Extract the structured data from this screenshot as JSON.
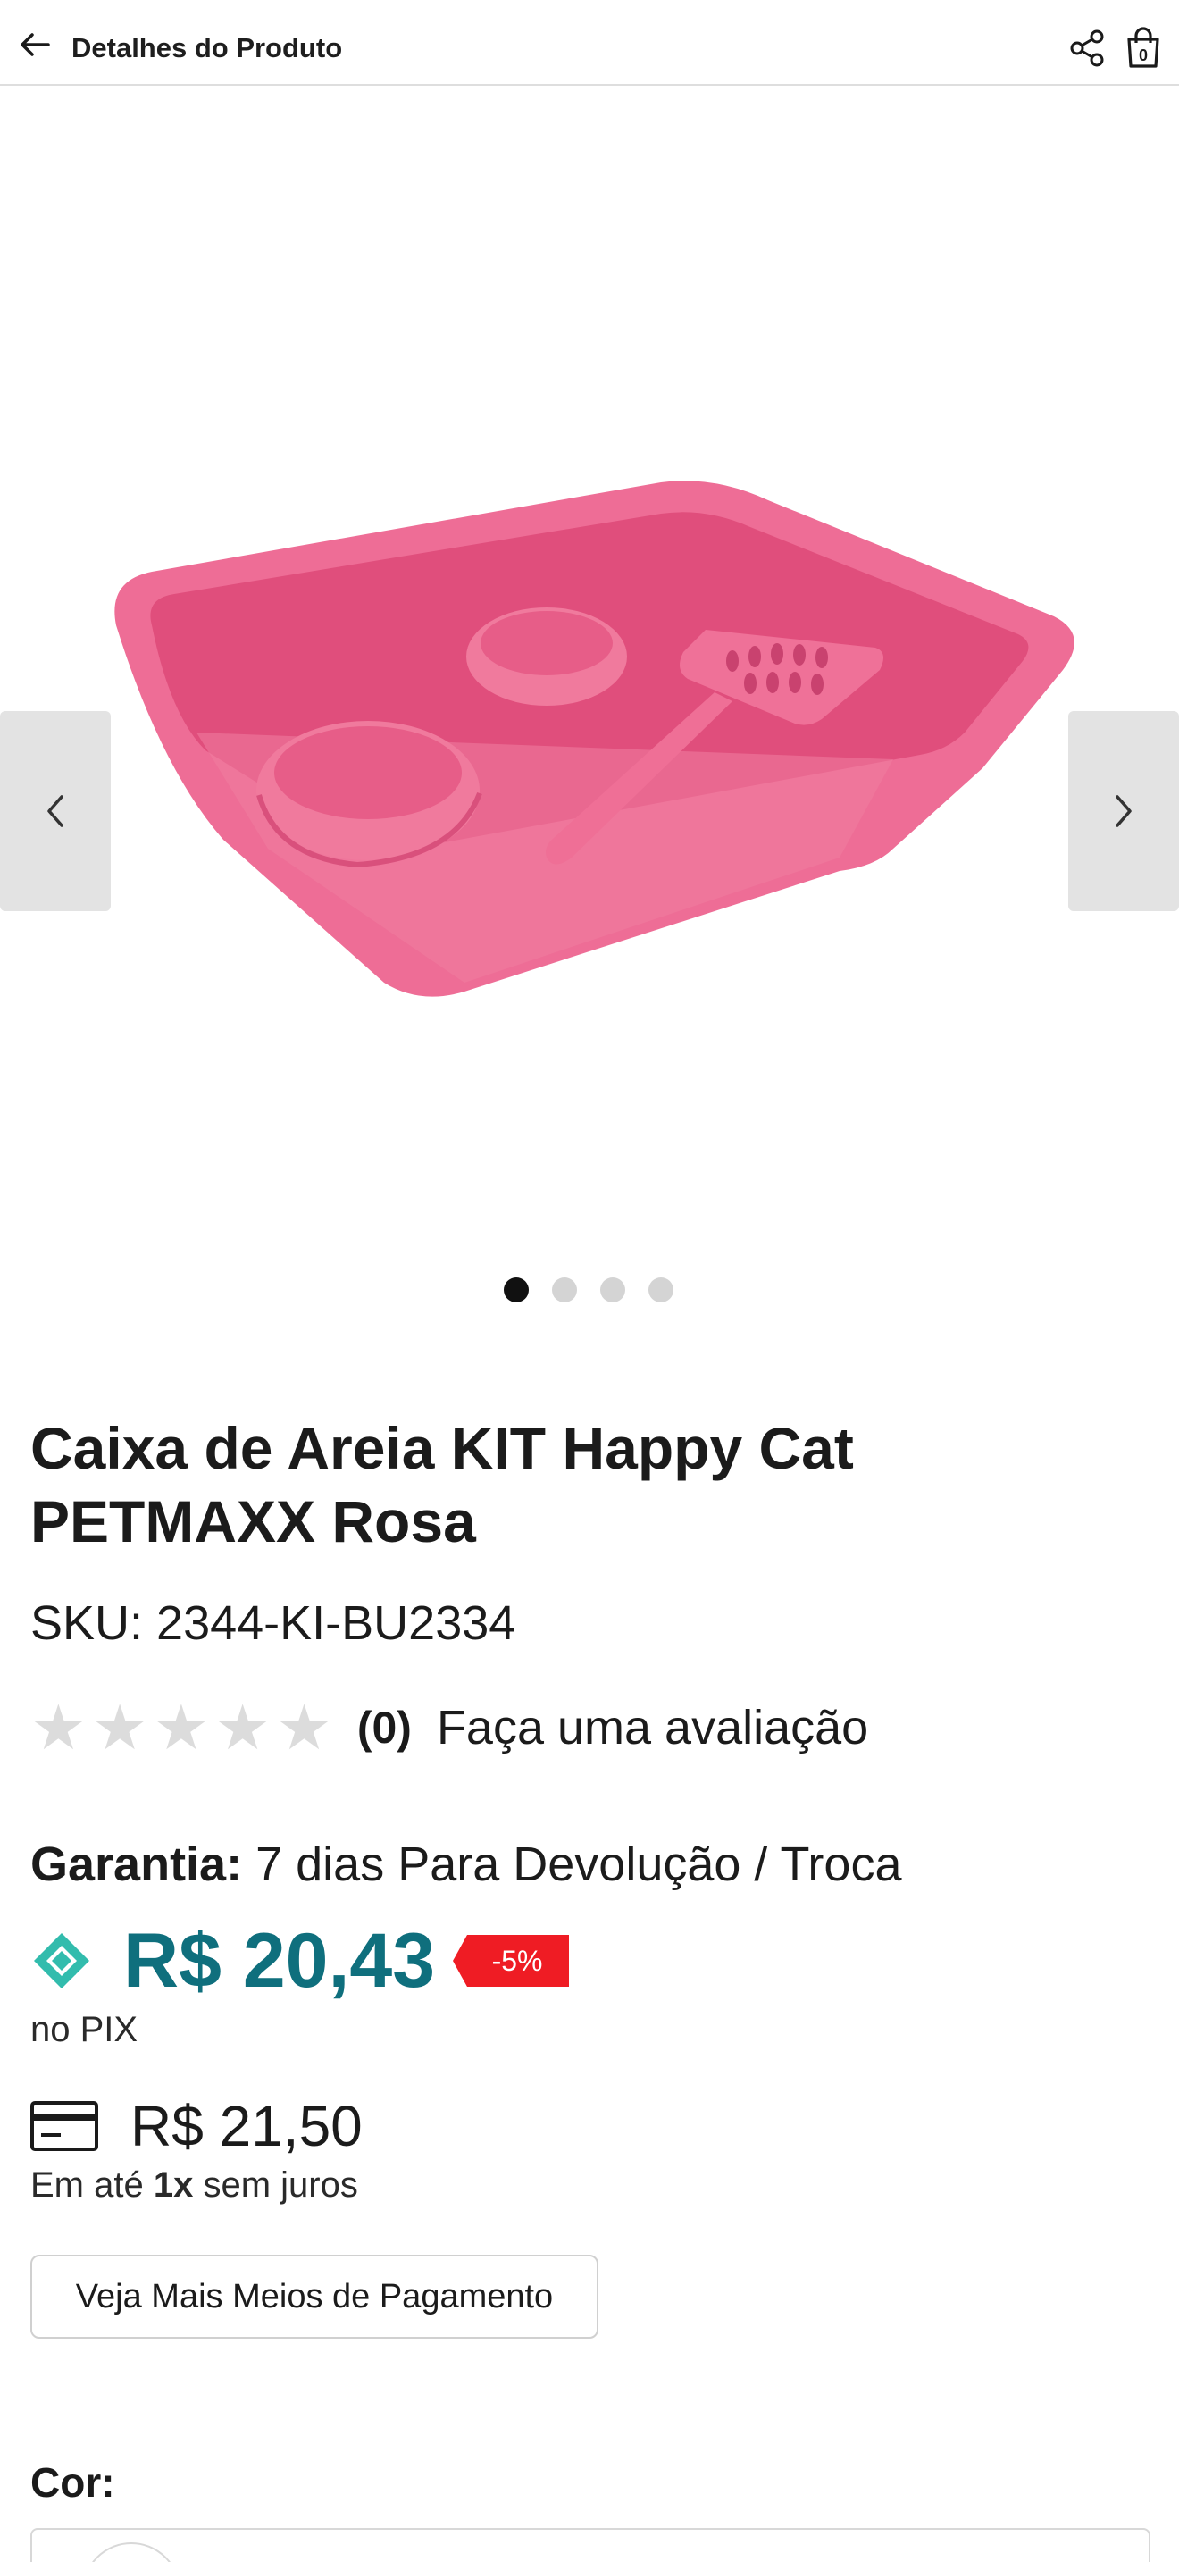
{
  "header": {
    "title": "Detalhes do Produto",
    "back_icon": "arrow-left-icon",
    "share_icon": "share-icon",
    "cart_icon": "shopping-bag-icon",
    "cart_count": "0"
  },
  "gallery": {
    "image_alt": "product-image",
    "prev_icon": "chevron-left-icon",
    "next_icon": "chevron-right-icon",
    "dots_total": 4,
    "dots_active": 1,
    "image_color": "#f06a95"
  },
  "product": {
    "title": "Caixa de Areia KIT Happy Cat PETMAXX Rosa",
    "sku": "SKU: 2344-KI-BU2334",
    "rating_stars": 0,
    "rating_count": "(0)",
    "rate_link": "Faça uma avaliação",
    "warranty_label": "Garantia:",
    "warranty_value": "7 dias Para Devolução / Troca"
  },
  "pricing": {
    "pix_icon": "pix-icon",
    "pix_price": "R$ 20,43",
    "discount": "-5%",
    "pix_note": "no PIX",
    "card_icon": "credit-card-icon",
    "card_price": "R$ 21,50",
    "installments_prefix": "Em até",
    "installments_count": "1x",
    "installments_suffix": "sem juros",
    "more_payments_button": "Veja Mais Meios de Pagamento",
    "pix_color": "#0f6f7d",
    "pix_icon_color": "#32bcad",
    "discount_color": "#ef1c24"
  },
  "variant": {
    "color_label": "Cor:"
  }
}
